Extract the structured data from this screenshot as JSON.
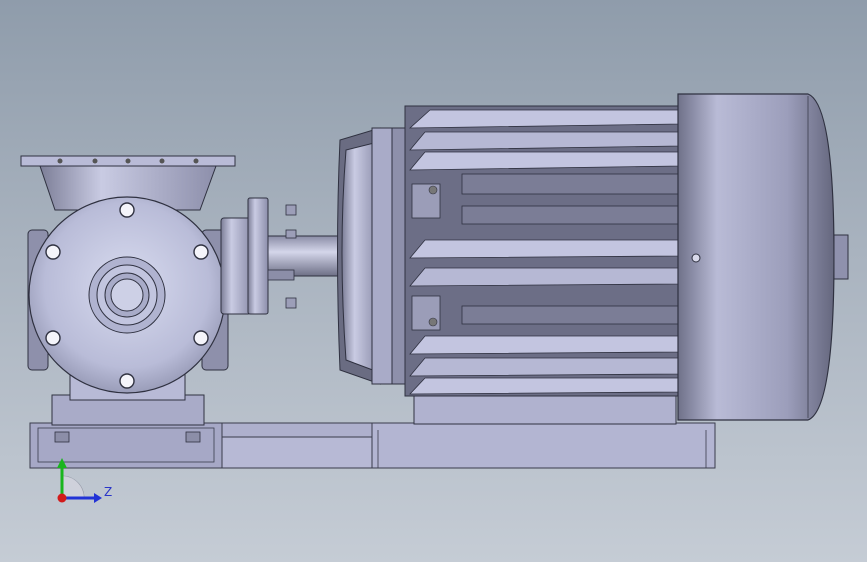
{
  "viewport": {
    "background_top": "#8f9cab",
    "background_bottom": "#c5ccd5"
  },
  "model": {
    "part_color": "#aaaccd",
    "part_dark": "#5d5f73",
    "edge_color": "#2f3140"
  },
  "triad": {
    "z_label": "Z",
    "x_color": "#d21a1a",
    "y_color": "#19b51d",
    "z_color": "#2233d6"
  }
}
